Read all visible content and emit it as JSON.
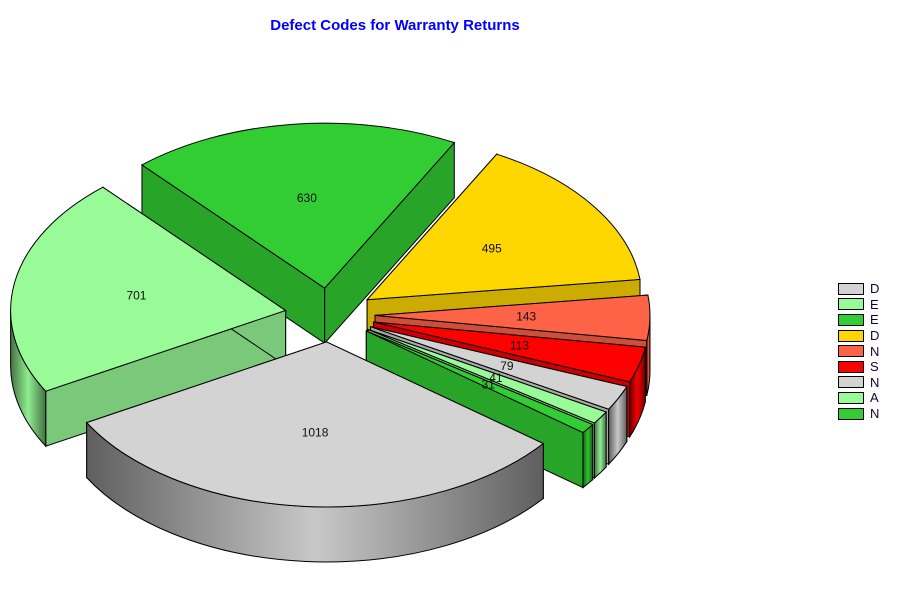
{
  "chart_data": {
    "type": "pie",
    "style": "3d-exploded",
    "title": "Defect Codes for Warranty Returns",
    "legend_position": "right",
    "slices": [
      {
        "label": "D",
        "value": 1018,
        "color": "#d3d3d3"
      },
      {
        "label": "E",
        "value": 701,
        "color": "#98fb98"
      },
      {
        "label": "E",
        "value": 630,
        "color": "#32cd32"
      },
      {
        "label": "D",
        "value": 495,
        "color": "#ffd700"
      },
      {
        "label": "N",
        "value": 143,
        "color": "#ff6347"
      },
      {
        "label": "S",
        "value": 113,
        "color": "#ff0000"
      },
      {
        "label": "N",
        "value": 79,
        "color": "#d3d3d3"
      },
      {
        "label": "A",
        "value": 41,
        "color": "#98fb98"
      },
      {
        "label": "N",
        "value": 31,
        "color": "#32cd32"
      }
    ]
  }
}
